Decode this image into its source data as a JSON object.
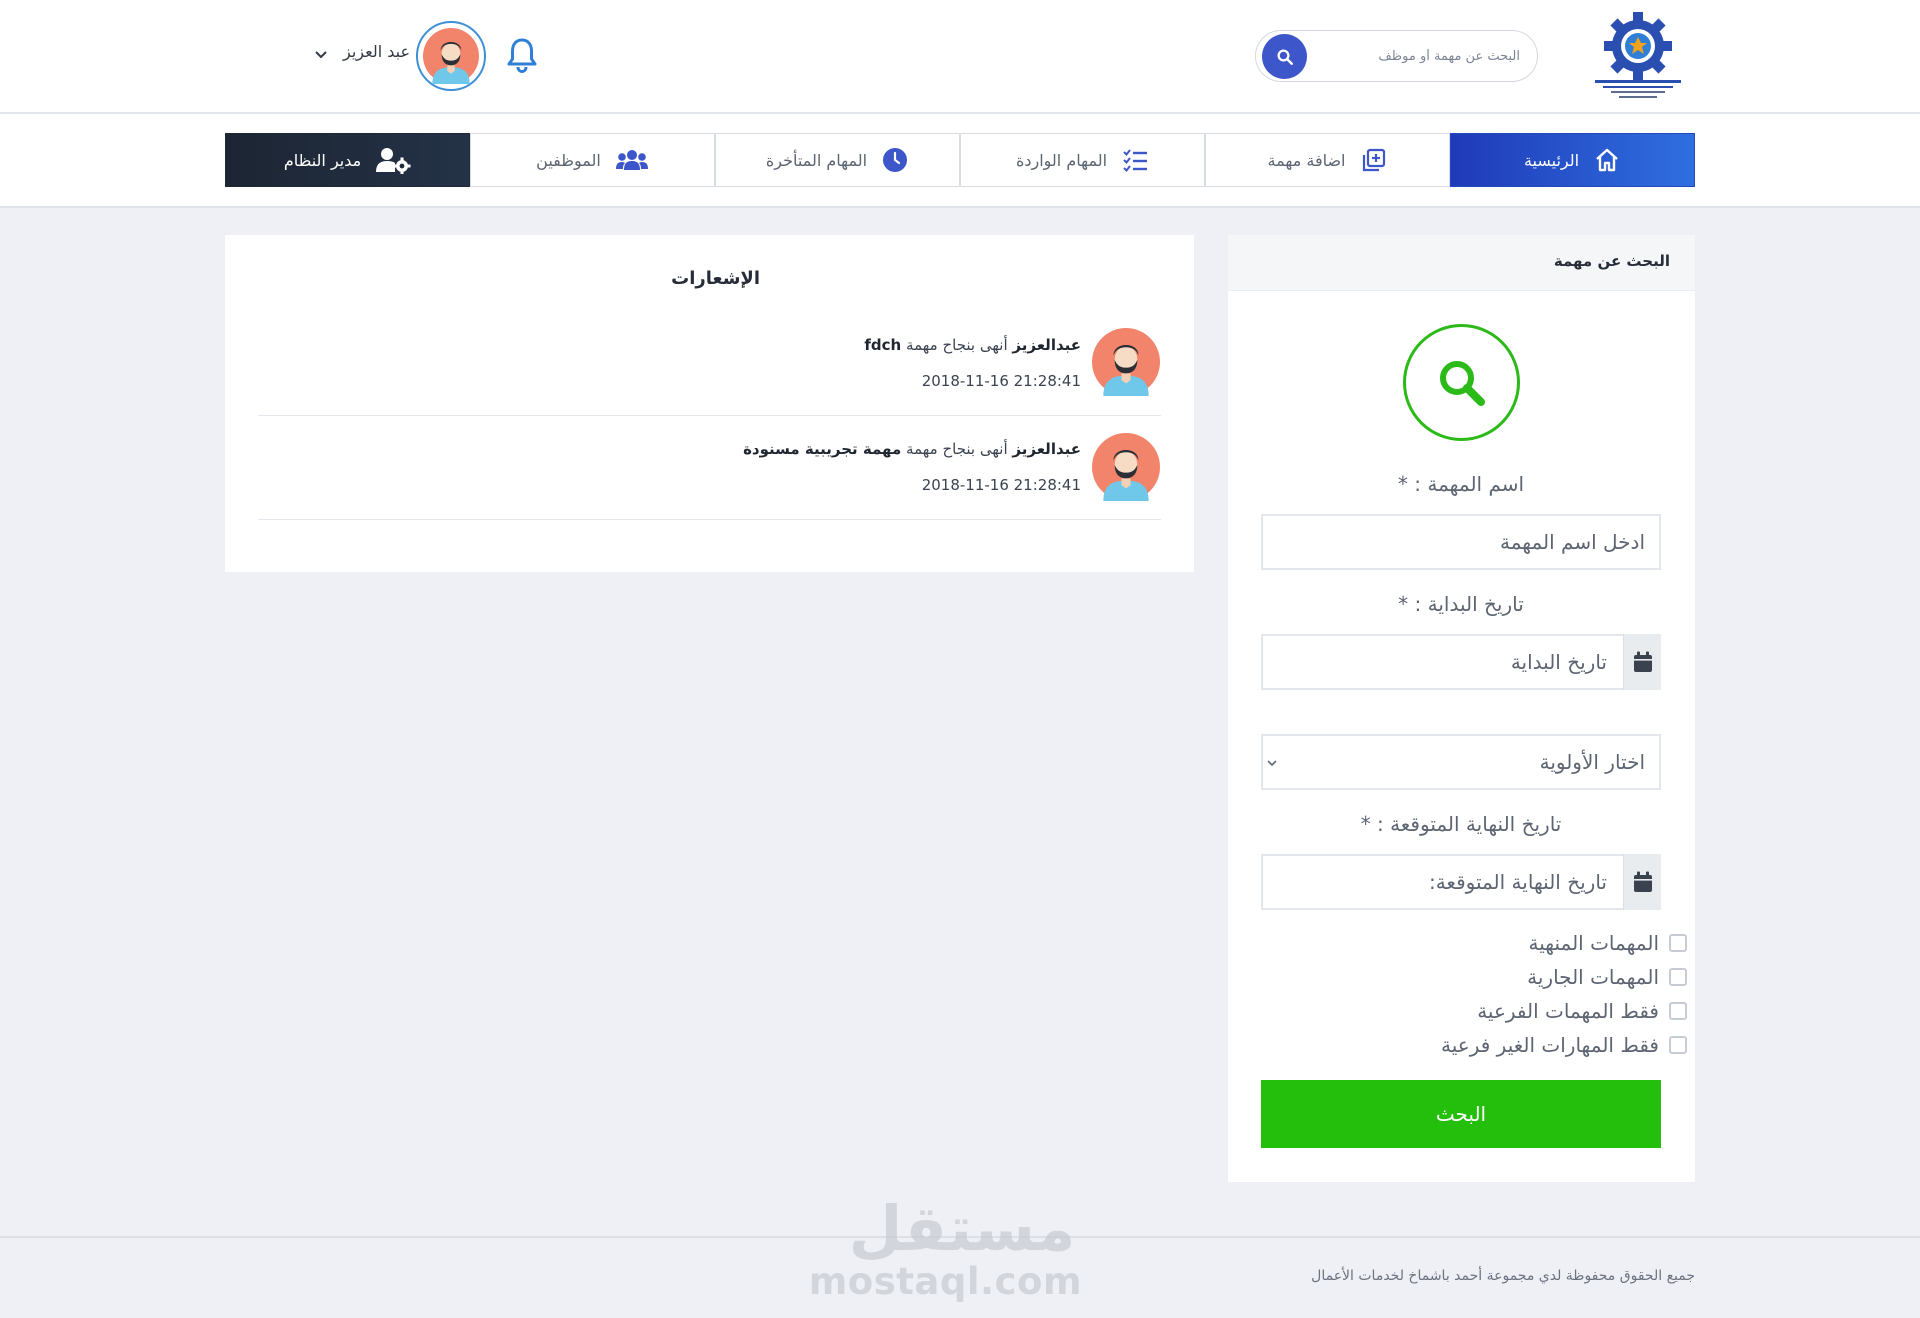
{
  "header": {
    "search_placeholder": "البحث عن مهمة أو موظف",
    "user_name": "عبد العزيز"
  },
  "nav": {
    "tabs": [
      {
        "label": "الرئيسية",
        "icon": "home-icon",
        "state": "active"
      },
      {
        "label": "اضافة مهمة",
        "icon": "add-square-icon",
        "state": "normal"
      },
      {
        "label": "المهام الواردة",
        "icon": "checklist-icon",
        "state": "normal"
      },
      {
        "label": "المهام المتأخرة",
        "icon": "clock-icon",
        "state": "normal"
      },
      {
        "label": "الموظفين",
        "icon": "users-icon",
        "state": "normal"
      },
      {
        "label": "مدير النظام",
        "icon": "user-cog-icon",
        "state": "dark"
      }
    ]
  },
  "notifications": {
    "title": "الإشعارات",
    "items": [
      {
        "actor": "عبدالعزيز",
        "action": "أنهى بنجاح مهمة",
        "task": "fdch",
        "time": "2018-11-16 21:28:41"
      },
      {
        "actor": "عبدالعزيز",
        "action": "أنهى بنجاح مهمة",
        "task": "مهمة تجريبية مسنودة",
        "time": "2018-11-16 21:28:41"
      }
    ]
  },
  "search_panel": {
    "title": "البحث عن مهمة",
    "task_name_label": "اسم المهمة : *",
    "task_name_placeholder": "ادخل اسم المهمة",
    "start_date_label": "تاريخ البداية : *",
    "start_date_placeholder": "تاريخ البداية",
    "priority_placeholder": "اختار الأولوية",
    "end_date_label": "تاريخ النهاية المتوقعة : *",
    "end_date_placeholder": "تاريخ النهاية المتوقعة:",
    "checkboxes": [
      {
        "label": "المهمات المنهية",
        "checked": false
      },
      {
        "label": "المهمات الجارية",
        "checked": false
      },
      {
        "label": "فقط المهمات الفرعية",
        "checked": false
      },
      {
        "label": "فقط المهارات الغير فرعية",
        "checked": false
      }
    ],
    "submit_label": "البحث"
  },
  "footer": {
    "copyright": "جميع الحقوق محفوظة لدي مجموعة أحمد باشماخ لخدمات الأعمال"
  },
  "watermark": {
    "arabic": "مستقل",
    "latin": "mostaql.com"
  },
  "colors": {
    "primary_blue": "#2f4fd0",
    "success_green": "#24be0d",
    "dark_nav": "#1c2533",
    "background": "#eef0f5"
  }
}
